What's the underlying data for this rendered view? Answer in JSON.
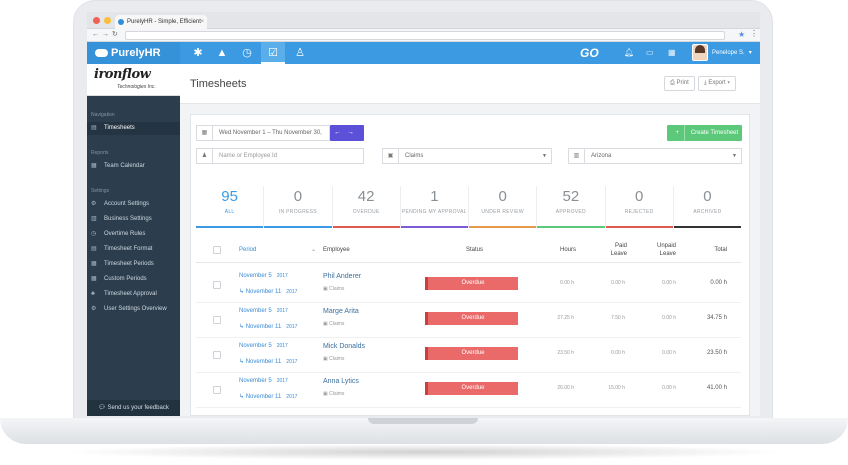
{
  "browser": {
    "tab_title": "PurelyHR - Simple, Efficient"
  },
  "appbar": {
    "brand": "PurelyHR",
    "go_label": "GO",
    "user_name": "Penelope S."
  },
  "sidebar": {
    "company_logo": "ironflow",
    "company_sub": "Technologies Inc.",
    "sections": {
      "navigation": "Navigation",
      "reports": "Reports",
      "settings": "Settings"
    },
    "items": {
      "timesheets": "Timesheets",
      "team_calendar": "Team Calendar",
      "account_settings": "Account Settings",
      "business_settings": "Business Settings",
      "overtime_rules": "Overtime Rules",
      "timesheet_format": "Timesheet Format",
      "timesheet_periods": "Timesheet Periods",
      "custom_periods": "Custom Periods",
      "timesheet_approval": "Timesheet Approval",
      "user_settings_overview": "User Settings Overview"
    },
    "feedback": "Send us your feedback"
  },
  "header": {
    "title": "Timesheets",
    "print_label": "Print",
    "export_label": "Export"
  },
  "filters": {
    "date_range": "Wed November 1 – Thu November 30,",
    "employee_placeholder": "Name or Employee Id",
    "category_value": "Claims",
    "location_value": "Arizona",
    "create_label": "Create Timesheet"
  },
  "stats": [
    {
      "count": "95",
      "label": "ALL",
      "color": "#3b9ae1"
    },
    {
      "count": "0",
      "label": "IN PROGRESS",
      "color": "#3b9ae1"
    },
    {
      "count": "42",
      "label": "OVERDUE",
      "color": "#e05a4f"
    },
    {
      "count": "1",
      "label": "PENDING MY APPROVAL",
      "color": "#7c5cd6"
    },
    {
      "count": "0",
      "label": "UNDER REVIEW",
      "color": "#e79a4b"
    },
    {
      "count": "52",
      "label": "APPROVED",
      "color": "#5cc87a"
    },
    {
      "count": "0",
      "label": "REJECTED",
      "color": "#e05a4f"
    },
    {
      "count": "0",
      "label": "ARCHIVED",
      "color": "#333333"
    }
  ],
  "table": {
    "headers": {
      "period": "Period",
      "employee": "Employee",
      "status": "Status",
      "hours": "Hours",
      "paid_leave_1": "Paid",
      "paid_leave_2": "Leave",
      "unpaid_leave_1": "Unpaid",
      "unpaid_leave_2": "Leave",
      "total": "Total"
    },
    "rows": [
      {
        "start": "November 5",
        "start_year": "2017",
        "end": "November 11",
        "end_year": "2017",
        "name": "Phil Anderer",
        "dept": "Claims",
        "status": "Overdue",
        "hours": "0.00 h",
        "paid": "0.00 h",
        "unpaid": "0.00 h",
        "total": "0.00 h"
      },
      {
        "start": "November 5",
        "start_year": "2017",
        "end": "November 11",
        "end_year": "2017",
        "name": "Marge Arita",
        "dept": "Claims",
        "status": "Overdue",
        "hours": "27.25 h",
        "paid": "7.50 h",
        "unpaid": "0.00 h",
        "total": "34.75 h"
      },
      {
        "start": "November 5",
        "start_year": "2017",
        "end": "November 11",
        "end_year": "2017",
        "name": "Mick Donalds",
        "dept": "Claims",
        "status": "Overdue",
        "hours": "23.50 h",
        "paid": "0.00 h",
        "unpaid": "0.00 h",
        "total": "23.50 h"
      },
      {
        "start": "November 5",
        "start_year": "2017",
        "end": "November 11",
        "end_year": "2017",
        "name": "Anna Lytics",
        "dept": "Claims",
        "status": "Overdue",
        "hours": "26.00 h",
        "paid": "15.00 h",
        "unpaid": "0.00 h",
        "total": "41.00 h"
      }
    ]
  }
}
